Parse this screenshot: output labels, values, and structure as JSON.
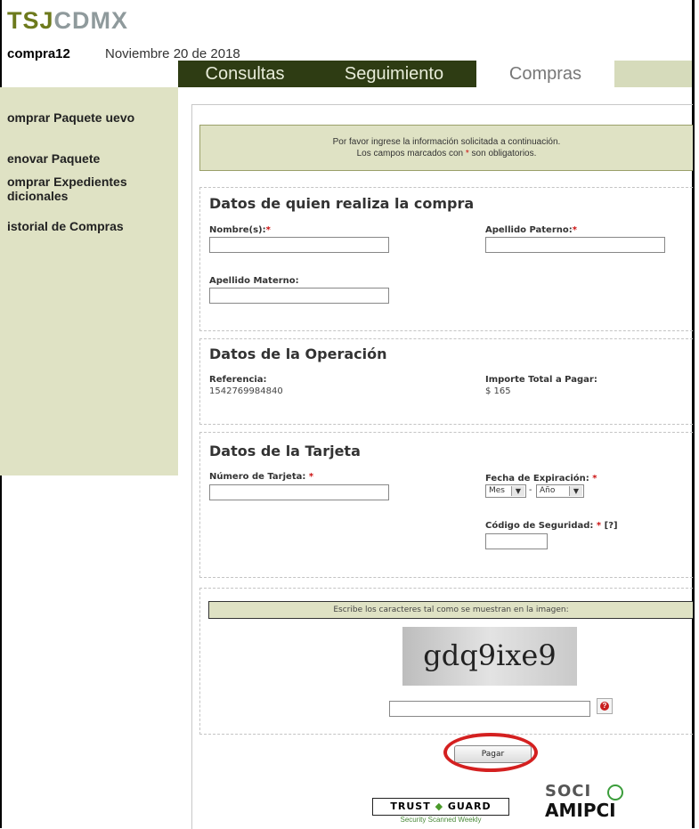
{
  "header": {
    "logo_part1": "TSJ",
    "logo_part2": "CDMX",
    "user": "compra12",
    "date": "Noviembre 20 de 2018"
  },
  "tabs": [
    {
      "label": "Consultas"
    },
    {
      "label": "Seguimiento"
    },
    {
      "label": "Compras",
      "active": true
    }
  ],
  "sidebar": {
    "items": [
      {
        "label": "omprar Paquete uevo"
      },
      {
        "label": "enovar Paquete"
      },
      {
        "label": "omprar Expedientes dicionales"
      },
      {
        "label": "istorial de Compras"
      }
    ]
  },
  "notice": {
    "line1": "Por favor ingrese la información solicitada a continuación.",
    "line2_before": "Los campos marcados con ",
    "asterisk": "*",
    "line2_after": " son obligatorios."
  },
  "buyer": {
    "title": "Datos de quien realiza la compra",
    "nombre_label": "Nombre(s):",
    "paterno_label": "Apellido Paterno:",
    "materno_label": "Apellido Materno:",
    "required_mark": "*"
  },
  "operation": {
    "title": "Datos de la Operación",
    "referencia_label": "Referencia:",
    "referencia_value": "1542769984840",
    "importe_label": "Importe Total a Pagar:",
    "importe_value": "$ 165"
  },
  "card": {
    "title": "Datos de la Tarjeta",
    "numero_label": "Número de Tarjeta:",
    "expiracion_label": "Fecha de Expiración:",
    "mes_selected": "Mes",
    "anio_selected": "Año",
    "separator": "-",
    "codigo_label": "Código de Seguridad:",
    "codigo_help": "[?]",
    "required_mark": "*"
  },
  "captcha": {
    "instruction": "Escribe los caracteres tal como se muestran en la imagen:",
    "image_text": "gdq9ixe9",
    "help_icon": "?"
  },
  "actions": {
    "pay_label": "Pagar"
  },
  "badges": {
    "trustguard_left": "TRUST",
    "trustguard_right": "GUARD",
    "trustguard_sub": "Security Scanned Weekly",
    "socio": "SOCI",
    "amipci": "AMIPCI"
  },
  "colors": {
    "accent_olive": "#6d7a1c",
    "tab_dark": "#2e3c13",
    "panel_bg": "#dfe2c4",
    "required_red": "#cc1111",
    "highlight_ring": "#d42020"
  }
}
